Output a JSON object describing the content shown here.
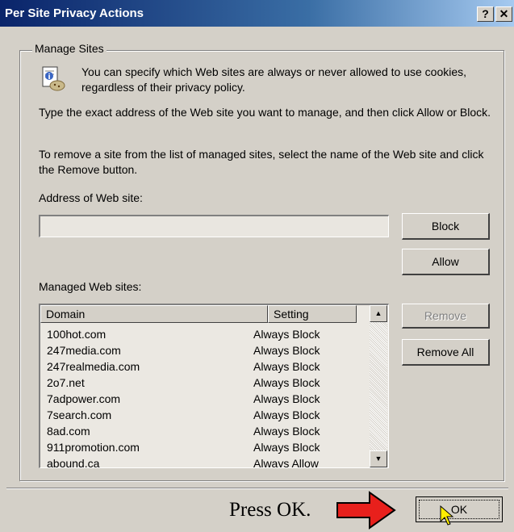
{
  "window": {
    "title": "Per Site Privacy Actions",
    "help_glyph": "?",
    "close_glyph": "✕"
  },
  "group": {
    "label": "Manage Sites",
    "icon": "privacy-info-icon",
    "intro": "You can specify which Web sites are always or never allowed to use cookies, regardless of their privacy policy.",
    "instructions": "Type the exact address of the Web site you want to manage, and then click Allow or Block.",
    "remove_instructions": "To remove a site from the list of managed sites, select the name of the Web site and click the Remove button.",
    "address_label": "Address of Web site:",
    "address_value": "",
    "managed_label": "Managed Web sites:"
  },
  "buttons": {
    "block": "Block",
    "allow": "Allow",
    "remove": "Remove",
    "remove_all": "Remove All",
    "ok": "OK"
  },
  "table": {
    "columns": [
      "Domain",
      "Setting"
    ],
    "rows": [
      {
        "domain": "100hot.com",
        "setting": "Always Block"
      },
      {
        "domain": "247media.com",
        "setting": "Always Block"
      },
      {
        "domain": "247realmedia.com",
        "setting": "Always Block"
      },
      {
        "domain": "2o7.net",
        "setting": "Always Block"
      },
      {
        "domain": "7adpower.com",
        "setting": "Always Block"
      },
      {
        "domain": "7search.com",
        "setting": "Always Block"
      },
      {
        "domain": "8ad.com",
        "setting": "Always Block"
      },
      {
        "domain": "911promotion.com",
        "setting": "Always Block"
      },
      {
        "domain": "abound.ca",
        "setting": "Always Allow"
      }
    ]
  },
  "annotation": {
    "text": "Press OK.",
    "arrow_color": "#e8201c"
  }
}
